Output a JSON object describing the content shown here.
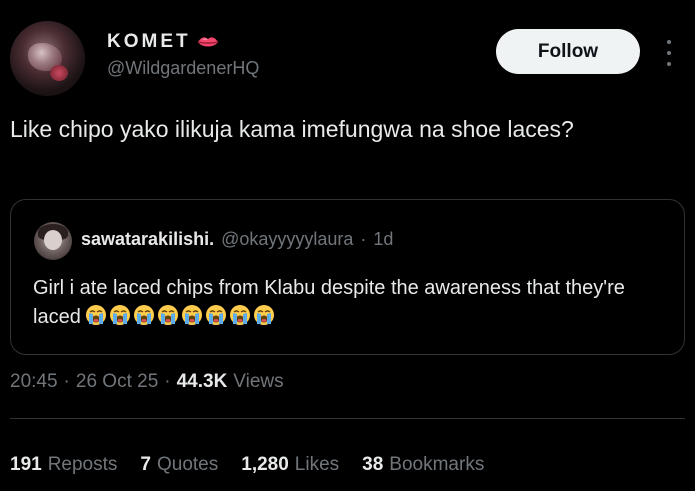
{
  "author": {
    "display_name": "KOMET",
    "handle": "@WildgardenerHQ",
    "avatar_icon": "profile-photo",
    "name_emoji": "lips-icon"
  },
  "follow_label": "Follow",
  "more_icon": "more-options-icon",
  "tweet": {
    "text": "Like chipo yako ilikuja kama imefungwa na shoe laces?"
  },
  "quote": {
    "display_name": "sawatarakilishi.",
    "handle": "@okayyyyylaura",
    "separator": "·",
    "time": "1d",
    "text": "Girl i ate laced chips from Klabu despite the awareness that they're laced",
    "emoji_count": 8,
    "emoji_icon": "loudly-crying-face-icon"
  },
  "meta": {
    "time": "20:45",
    "sep1": "·",
    "date": "26 Oct 25",
    "sep2": "·",
    "views_count": "44.3K",
    "views_label": "Views"
  },
  "stats": {
    "reposts_count": "191",
    "reposts_label": "Reposts",
    "quotes_count": "7",
    "quotes_label": "Quotes",
    "likes_count": "1,280",
    "likes_label": "Likes",
    "bookmarks_count": "38",
    "bookmarks_label": "Bookmarks"
  },
  "colors": {
    "background": "#000000",
    "text_primary": "#e7e9ea",
    "text_secondary": "#71767b",
    "border": "#2f3336",
    "follow_bg": "#eff3f4"
  }
}
